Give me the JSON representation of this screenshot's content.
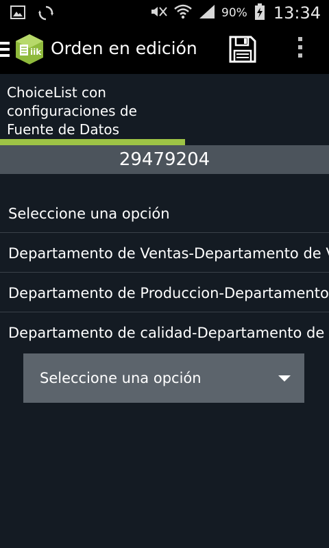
{
  "status_bar": {
    "battery_percent": "90%",
    "time": "13:34",
    "icons": [
      "gallery-icon",
      "sync-icon",
      "mute-icon",
      "wifi-icon",
      "signal-icon",
      "battery-charging-icon"
    ]
  },
  "app_bar": {
    "title": "Orden en edición",
    "icons": [
      "menu-icon",
      "app-logo-icon",
      "save-icon",
      "overflow-menu-icon"
    ]
  },
  "field": {
    "label_lines": [
      "ChoiceList con",
      "configuraciones de",
      "Fuente de Datos"
    ],
    "value": "29479204"
  },
  "options": [
    "Seleccione una opción",
    "Departamento de Ventas-Departamento de Ventas",
    "Departamento de Produccion-Departamento de Produccion",
    "Departamento de calidad-Departamento de calidad"
  ],
  "dropdown": {
    "selected": "Seleccione una opción"
  },
  "colors": {
    "background": "#141b23",
    "accent": "#9ec446",
    "value_bar": "#4c545c",
    "dropdown": "#5c646c"
  }
}
